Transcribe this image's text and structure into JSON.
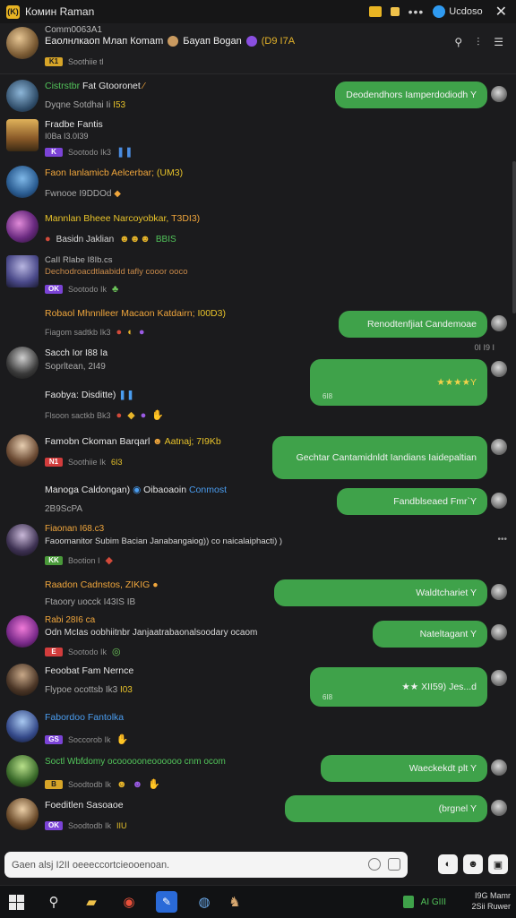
{
  "titlebar": {
    "app_icon": "(K)",
    "title": "Комин Raman",
    "account": "Ucdoso",
    "close": "✕",
    "dots": "•••"
  },
  "header": {
    "subtitle": "Comm0063A1",
    "name": "Еаолнлкаоп Млап Кomam",
    "name2": "Бауап Bogan",
    "extra": "(D9 I7A",
    "meta": "Soothiie tl",
    "tag": "K1"
  },
  "messages": [
    {
      "name": "Cistrstbr",
      "name_rest": "Fat Gtooronet",
      "text": "Dyqne Sotdhai Ii",
      "meta_num": "I53",
      "tag": ""
    },
    {
      "name": "Fradbe Fantis",
      "text": "I0Ba I3.0I39",
      "meta": "Sootodo Ik3",
      "tag": "K"
    },
    {
      "name": "Faon Ianlamicb Aelcerbar;",
      "name_rest": "(UM3)",
      "text": "Fwnooe I9DDOd",
      "tag": ""
    },
    {
      "name": "Mannlan Bheee Narcoyobkar,",
      "name_rest": "T3DI3)",
      "text": "Basidn Jaklian",
      "meta_num": "BBIS",
      "tag": ""
    },
    {
      "name": "CaII Rlabe I8Ib.cs",
      "text": "Dechodroacdtlaabidd tafly cooor ooco",
      "meta": "Sootodo Ik",
      "tag": "OK"
    },
    {
      "name": "Robaol Mhnnlleer Macaon Katdairn;",
      "name_rest": "I00D3)",
      "text": "Fiagom sadtkb Ik3",
      "tag": ""
    },
    {
      "name": "Sacch Ior I88 Ia",
      "text": "Soprltean, 2I49",
      "tag": ""
    },
    {
      "name": "Faobya: Disditte)",
      "text": "Flsoon sactkb Bk3",
      "tag": ""
    },
    {
      "name": "Famobn Ckoman Barqarl",
      "name_rest": "Aatnaj; 7I9Kb",
      "text": "Soothiie Ik",
      "meta_num": "6I3",
      "tag": "N1"
    },
    {
      "name": "Manoga Caldongan)",
      "name_rest": "Oibaoaoin",
      "name_rest2": "Conmost",
      "text": "2B9ScPA",
      "tag": ""
    },
    {
      "name": "Fiaonan I68.c3",
      "text": "Faoomanitor Subim Bacian Janabangaiog)) co naicalaiphacti) )",
      "meta": "Bootion I",
      "tag": "KK"
    },
    {
      "name": "Raadon Cadnstos, ZIKIG",
      "text": "Ftaoory uocck I43IS IB",
      "tag": ""
    },
    {
      "name": "Rabi 28I6 ca",
      "text": "Odn McIas oobhiitnbr Janjaatrabaonalsoodary ocaom",
      "meta": "Sootodo Ik",
      "tag": "E"
    },
    {
      "name": "Feoobat Fam Nernce",
      "text": "Flypoe ocottsb Ik3",
      "meta_num": "I03",
      "tag": ""
    },
    {
      "name": "Fabordoo Fantolka",
      "meta": "Soccorob Ik",
      "tag": "GS"
    },
    {
      "name": "Soctl Wbfdomy ocoooooneoooooo cnm ocom",
      "meta": "Soodtodb Ik",
      "tag": "B"
    },
    {
      "name": "Foeditlen Sasoaoe",
      "meta": "Soodtodb Ik",
      "tag": "OK",
      "meta_num": "IIU"
    }
  ],
  "bubbles": [
    {
      "text": "Deodendhors Iamperdodiodh Y"
    },
    {
      "text": "Renodtenfjiat Candemoae"
    },
    {
      "text": "★★★★Y",
      "time": "6I8"
    },
    {
      "text": "Gechtar Cantamidnldt Iandians Iaidepaltian"
    },
    {
      "text": "Fandblseaed Fmr`Y"
    },
    {
      "text": "Waldtchariet Y"
    },
    {
      "text": "Nateltagant Y"
    },
    {
      "text": "★★ XII59) Jes...d",
      "time": "6I8"
    },
    {
      "text": "Waeckekdt plt Y"
    },
    {
      "text": "(brgnel Y"
    }
  ],
  "stray": {
    "time": "0I I9 I",
    "more": "•••"
  },
  "input": {
    "placeholder": "Gaen alsj I2II oeeeccortcieooenoan."
  },
  "taskbar": {
    "time": "I9G Mamr",
    "date": "2Sii Ruwer",
    "tray_text": "AI GIII"
  },
  "colors": {
    "bubble": "#3fa24a",
    "background": "#1b1b1d",
    "accent_gold": "#e7b52a",
    "name_green": "#52c45a"
  }
}
